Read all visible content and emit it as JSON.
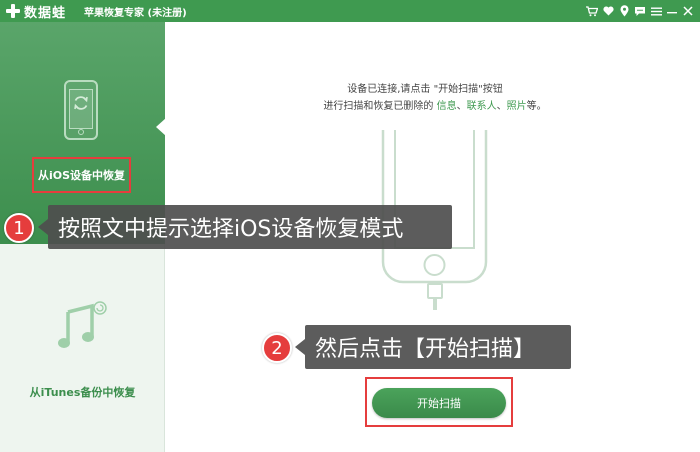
{
  "titlebar": {
    "brand": "数据蛙",
    "app_title": "苹果恢复专家 (未注册)",
    "icons": [
      "cart-icon",
      "heart-icon",
      "location-icon",
      "chat-icon",
      "menu-icon",
      "minimize-icon",
      "close-icon"
    ],
    "background_color": "#3f9a50"
  },
  "sidebar": {
    "items": [
      {
        "label": "从iOS设备中恢复",
        "icon": "iphone-refresh-icon",
        "active": true
      },
      {
        "label": "从iTunes备份中恢复",
        "icon": "music-note-icon",
        "active": false
      }
    ],
    "active_color": "#3c8e4d"
  },
  "main": {
    "instruction_line1": "设备已连接,请点击 \"开始扫描\"按钮",
    "instruction_line2_prefix": "进行扫描和恢复已删除的 ",
    "instruction_links": [
      "信息",
      "联系人",
      "照片"
    ],
    "instruction_sep": "、",
    "instruction_line2_suffix": "等。",
    "scan_button_label": "开始扫描",
    "accent_color": "#3f9a50"
  },
  "annotations": [
    {
      "number": "1",
      "text": "按照文中提示选择iOS设备恢复模式"
    },
    {
      "number": "2",
      "text": "然后点击【开始扫描】"
    }
  ],
  "highlight_color": "#e53d3d"
}
